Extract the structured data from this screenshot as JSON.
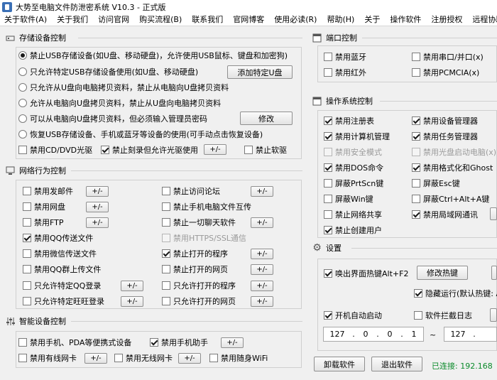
{
  "window": {
    "title": "大势至电脑文件防泄密系统 V10.3 - 正式版"
  },
  "menu": [
    "关于软件(A)",
    "关于我们",
    "访问官网",
    "购买流程(B)",
    "联系我们",
    "官网博客",
    "使用必读(R)",
    "帮助(H)",
    "关于",
    "操作软件",
    "注册授权",
    "远程协助"
  ],
  "storage": {
    "title": "存储设备控制",
    "radios": [
      {
        "label": "禁止USB存储设备(如U盘、移动硬盘)，允许使用USB鼠标、键盘和加密狗)",
        "checked": true
      },
      {
        "label": "只允许特定USB存储设备使用(如U盘、移动硬盘)",
        "checked": false
      },
      {
        "label": "只允许从U盘向电脑拷贝资料，禁止从电脑向U盘拷贝资料",
        "checked": false
      },
      {
        "label": "允许从电脑向U盘拷贝资料，禁止从U盘向电脑拷贝资料",
        "checked": false
      },
      {
        "label": "可以从电脑向U盘拷贝资料，但必须输入管理员密码",
        "checked": false
      },
      {
        "label": "恢复USB存储设备、手机或蓝牙等设备的使用(可手动点击恢复设备)",
        "checked": false
      }
    ],
    "add_usb_button": "添加特定U盘",
    "modify_button": "修改",
    "cd_dvd": "禁用CD/DVD光驱",
    "burn": "禁止刻录但允许光驱使用",
    "floppy": "禁止软驱",
    "pm": "+/-"
  },
  "network": {
    "title": "网络行为控制",
    "left": [
      {
        "label": "禁用发邮件",
        "checked": false
      },
      {
        "label": "禁用网盘",
        "checked": false
      },
      {
        "label": "禁用FTP",
        "checked": false
      },
      {
        "label": "禁用QQ传送文件",
        "checked": true
      },
      {
        "label": "禁用微信传送文件",
        "checked": false
      },
      {
        "label": "禁用QQ群上传文件",
        "checked": false
      },
      {
        "label": "只允许特定QQ登录",
        "checked": false
      },
      {
        "label": "只允许特定旺旺登录",
        "checked": false
      }
    ],
    "right": [
      {
        "label": "禁止访问论坛",
        "checked": false
      },
      {
        "label": "禁止手机电脑文件互传",
        "checked": false
      },
      {
        "label": "禁止一切聊天软件",
        "checked": false
      },
      {
        "label": "禁用HTTPS/SSL通信",
        "checked": false
      },
      {
        "label": "禁止打开的程序",
        "checked": true
      },
      {
        "label": "禁止打开的网页",
        "checked": false
      },
      {
        "label": "只允许打开的程序",
        "checked": false
      },
      {
        "label": "只允许打开的网页",
        "checked": false
      }
    ]
  },
  "smart": {
    "title": "智能设备控制",
    "pda": "禁用手机、PDA等便携式设备",
    "assistant": "禁用手机助手",
    "wired": "禁用有线网卡",
    "wireless": "禁用无线网卡",
    "wifi": "禁用随身WiFi"
  },
  "ports": {
    "title": "端口控制",
    "items": [
      "禁用蓝牙",
      "禁用串口/并口(x)",
      "禁用红外",
      "禁用PCMCIA(x)"
    ]
  },
  "os": {
    "title": "操作系统控制",
    "items": [
      {
        "label": "禁用注册表",
        "checked": true
      },
      {
        "label": "禁用设备管理器",
        "checked": true
      },
      {
        "label": "禁用计算机管理",
        "checked": true
      },
      {
        "label": "禁用任务管理器",
        "checked": true
      },
      {
        "label": "禁用安全模式",
        "checked": false,
        "disabled": true
      },
      {
        "label": "禁用光盘启动电脑(x)",
        "checked": false,
        "disabled": true
      },
      {
        "label": "禁用DOS命令",
        "checked": true
      },
      {
        "label": "禁用格式化和Ghost",
        "checked": true
      },
      {
        "label": "屏蔽PrtScn键",
        "checked": false
      },
      {
        "label": "屏蔽Esc键",
        "checked": false
      },
      {
        "label": "屏蔽Win键",
        "checked": false
      },
      {
        "label": "屏蔽Ctrl+Alt+A键",
        "checked": false
      },
      {
        "label": "禁止网络共享",
        "checked": false
      },
      {
        "label": "禁用局域网通讯",
        "checked": true
      },
      {
        "label": "禁止创建用户",
        "checked": true
      }
    ]
  },
  "settings": {
    "title": "设置",
    "hotkey": "唤出界面热键Alt+F2",
    "modify_hotkey": "修改热键",
    "hidden_run": "隐藏运行(默认热键: Al",
    "autostart": "开机自动启动",
    "intercept_log": "软件拦截日志",
    "ip_from": [
      "127",
      "0",
      "0",
      "1"
    ],
    "ip_to_first": "127",
    "tilde": "~"
  },
  "footer": {
    "uninstall": "卸载软件",
    "exit": "退出软件",
    "status": "已连接: 192.168"
  },
  "colors": {
    "title_bg": "#ffffff",
    "status_green": "#0a8a2a"
  }
}
